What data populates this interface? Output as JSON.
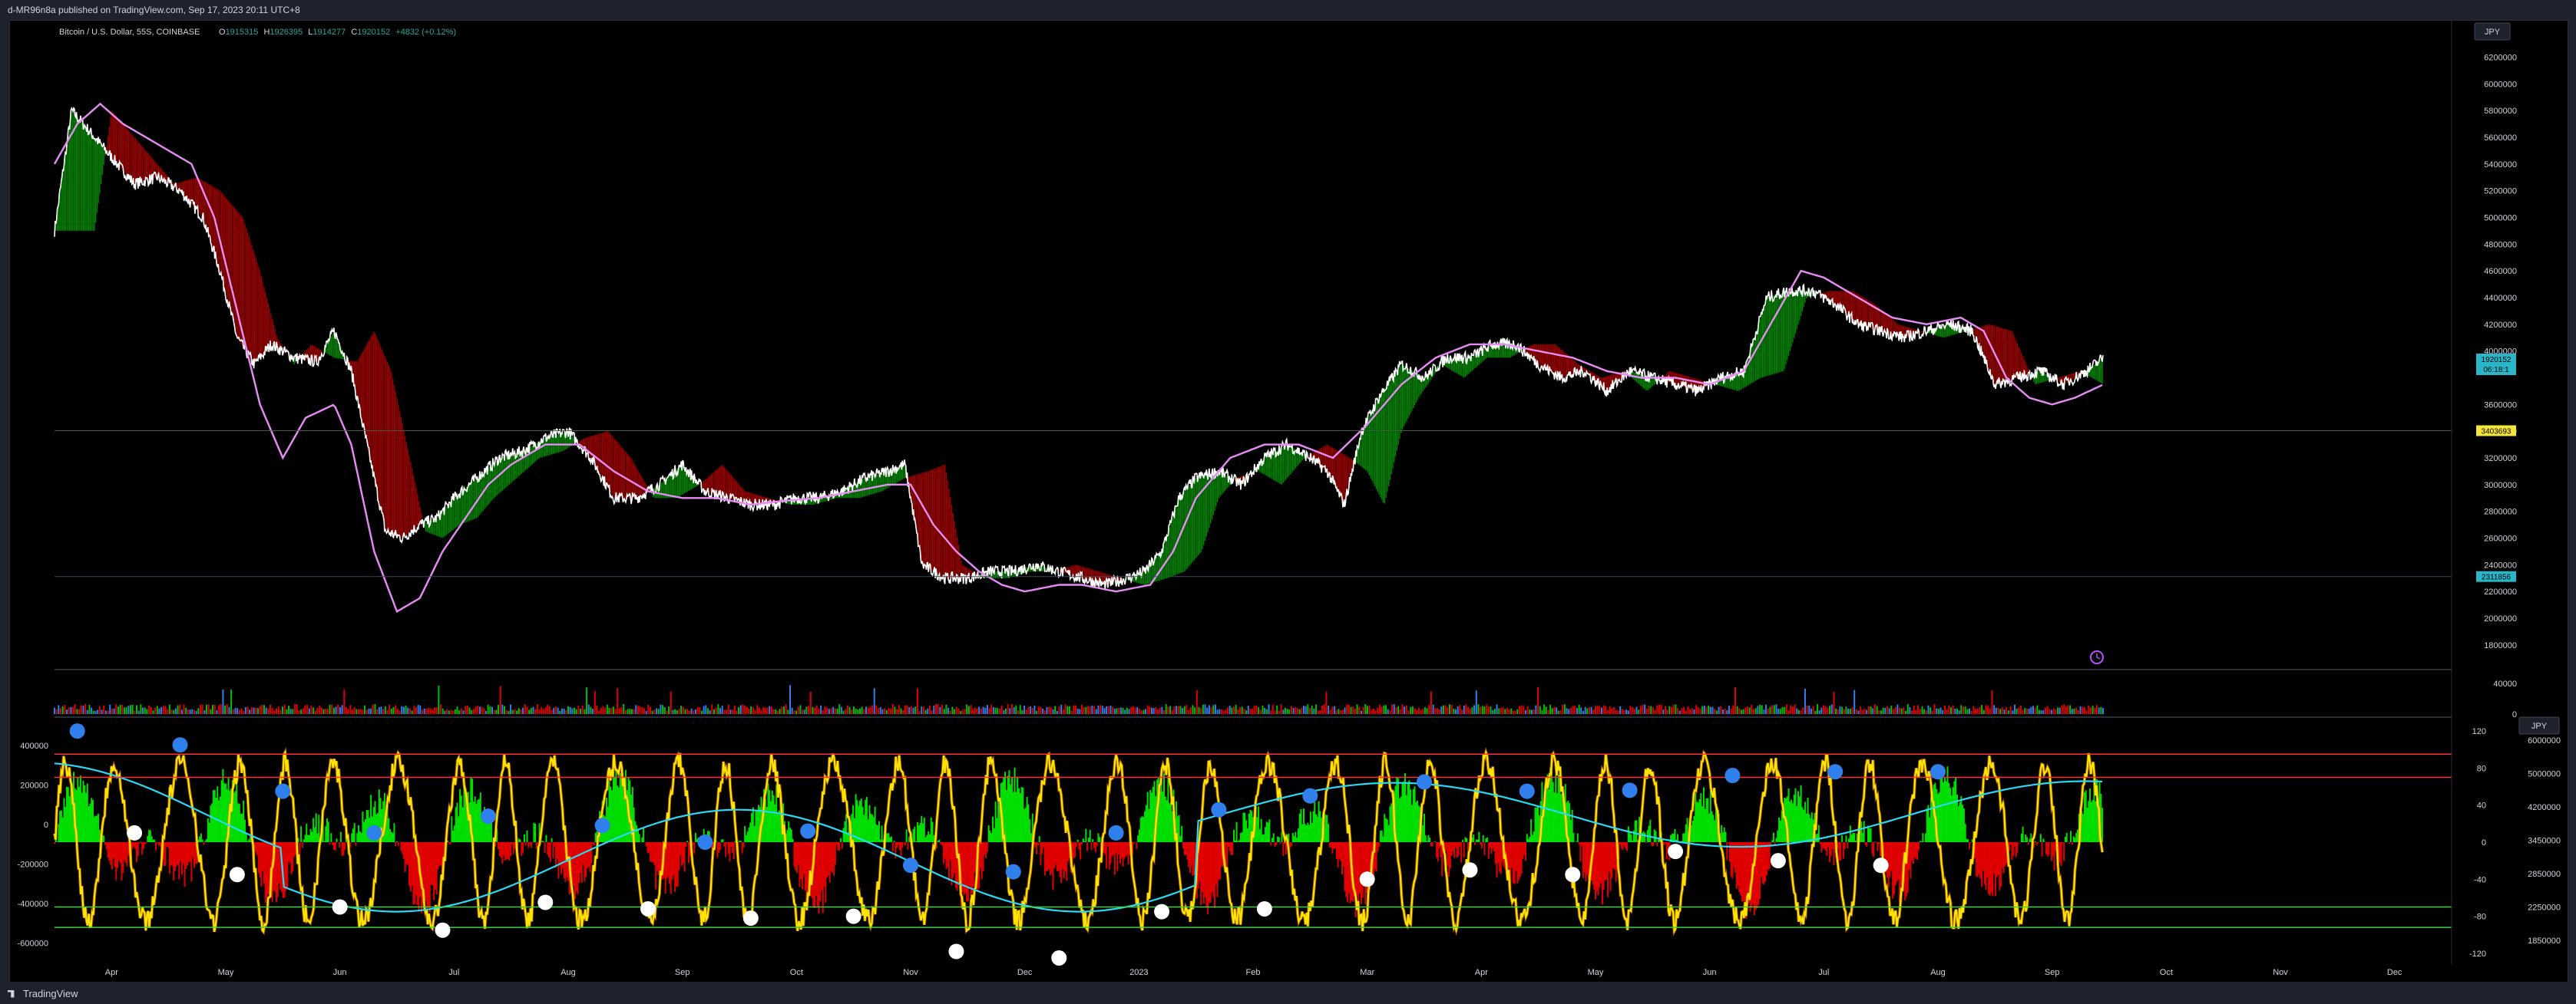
{
  "publish_line": "d-MR96n8a published on TradingView.com, Sep 17, 2023 20:11 UTC+8",
  "brand": "TradingView",
  "header": {
    "symbol": "Bitcoin / U.S. Dollar, 55S, COINBASE",
    "o_label": "O",
    "o_value": "1915315",
    "h_label": "H",
    "h_value": "1926395",
    "l_label": "L",
    "l_value": "1914277",
    "c_label": "C",
    "c_value": "1920152",
    "change": "+4832 (+0.12%)"
  },
  "currency_main": "JPY",
  "currency_osc": "JPY",
  "price_tag": "1920152",
  "countdown": "06:18:1",
  "hline_upper_value": "3403693",
  "hline_lower_value": "2311856",
  "colors": {
    "background": "#000000",
    "price_line": "#ffffff",
    "ma_magenta": "#e88cf5",
    "ribbon_up": "#00c000",
    "ribbon_down": "#e00000",
    "osc_yellow": "#ffe500",
    "osc_cyan": "#29d9f5",
    "hist_up": "#00e000",
    "hist_down": "#e00000",
    "level_red": "#ff3030",
    "level_green": "#40d040",
    "dot_blue": "#2f80ed",
    "dot_white": "#ffffff",
    "tag_blue": "#29b6c8",
    "tag_yellow": "#f5e53a"
  },
  "chart_data": [
    {
      "type": "line",
      "pane": "price",
      "x_ticks": [
        "Apr",
        "May",
        "Jun",
        "Jul",
        "Aug",
        "Sep",
        "Oct",
        "Nov",
        "Dec",
        "2023",
        "Feb",
        "Mar",
        "Apr",
        "May",
        "Jun",
        "Jul",
        "Aug",
        "Sep",
        "Oct",
        "Nov",
        "Dec"
      ],
      "x_tick_pos": [
        0.5,
        1.5,
        2.5,
        3.5,
        4.5,
        5.5,
        6.5,
        7.5,
        8.5,
        9.5,
        10.5,
        11.5,
        12.5,
        13.5,
        14.5,
        15.5,
        16.5,
        17.5,
        18.5,
        19.5,
        20.5
      ],
      "x_range": [
        0,
        21
      ],
      "y_ticks": [
        "6200000",
        "6000000",
        "5800000",
        "5600000",
        "5400000",
        "5200000",
        "5000000",
        "4800000",
        "4600000",
        "4400000",
        "4200000",
        "4000000",
        "3600000",
        "3400000",
        "3200000",
        "3000000",
        "2800000",
        "2600000",
        "2400000",
        "2200000",
        "2000000",
        "1800000"
      ],
      "ylim": [
        1650000,
        6300000
      ],
      "series": [
        {
          "values": [
            [
              0,
              4900000
            ],
            [
              0.15,
              5800000
            ],
            [
              0.3,
              5650000
            ],
            [
              0.5,
              5450000
            ],
            [
              0.7,
              5250000
            ],
            [
              0.9,
              5300000
            ],
            [
              1.1,
              5200000
            ],
            [
              1.3,
              5000000
            ],
            [
              1.45,
              4600000
            ],
            [
              1.6,
              4100000
            ],
            [
              1.75,
              3900000
            ],
            [
              1.9,
              4050000
            ],
            [
              2.1,
              3950000
            ],
            [
              2.3,
              3920000
            ],
            [
              2.45,
              4150000
            ],
            [
              2.6,
              3850000
            ],
            [
              2.75,
              3250000
            ],
            [
              2.9,
              2650000
            ],
            [
              3.05,
              2600000
            ],
            [
              3.2,
              2700000
            ],
            [
              3.35,
              2750000
            ],
            [
              3.5,
              2900000
            ],
            [
              3.7,
              3050000
            ],
            [
              3.9,
              3200000
            ],
            [
              4.1,
              3250000
            ],
            [
              4.3,
              3350000
            ],
            [
              4.5,
              3400000
            ],
            [
              4.7,
              3200000
            ],
            [
              4.9,
              2900000
            ],
            [
              5.1,
              2900000
            ],
            [
              5.3,
              3000000
            ],
            [
              5.5,
              3150000
            ],
            [
              5.7,
              2950000
            ],
            [
              5.9,
              2900000
            ],
            [
              6.1,
              2850000
            ],
            [
              6.3,
              2850000
            ],
            [
              6.5,
              2900000
            ],
            [
              6.7,
              2900000
            ],
            [
              6.9,
              2950000
            ],
            [
              7.1,
              3050000
            ],
            [
              7.3,
              3100000
            ],
            [
              7.45,
              3150000
            ],
            [
              7.6,
              2400000
            ],
            [
              7.8,
              2300000
            ],
            [
              8.0,
              2300000
            ],
            [
              8.2,
              2350000
            ],
            [
              8.4,
              2350000
            ],
            [
              8.6,
              2400000
            ],
            [
              8.8,
              2350000
            ],
            [
              9.0,
              2300000
            ],
            [
              9.2,
              2250000
            ],
            [
              9.4,
              2300000
            ],
            [
              9.55,
              2350000
            ],
            [
              9.7,
              2500000
            ],
            [
              9.85,
              2900000
            ],
            [
              10.0,
              3050000
            ],
            [
              10.2,
              3100000
            ],
            [
              10.4,
              3000000
            ],
            [
              10.6,
              3200000
            ],
            [
              10.8,
              3300000
            ],
            [
              11.0,
              3200000
            ],
            [
              11.15,
              3100000
            ],
            [
              11.3,
              2850000
            ],
            [
              11.45,
              3400000
            ],
            [
              11.6,
              3650000
            ],
            [
              11.8,
              3900000
            ],
            [
              12.0,
              3800000
            ],
            [
              12.2,
              3950000
            ],
            [
              12.4,
              3950000
            ],
            [
              12.6,
              4050000
            ],
            [
              12.8,
              4050000
            ],
            [
              13.0,
              3900000
            ],
            [
              13.2,
              3800000
            ],
            [
              13.4,
              3850000
            ],
            [
              13.6,
              3700000
            ],
            [
              13.8,
              3850000
            ],
            [
              14.0,
              3800000
            ],
            [
              14.2,
              3750000
            ],
            [
              14.4,
              3700000
            ],
            [
              14.6,
              3800000
            ],
            [
              14.8,
              3850000
            ],
            [
              15.0,
              4400000
            ],
            [
              15.2,
              4450000
            ],
            [
              15.4,
              4450000
            ],
            [
              15.6,
              4350000
            ],
            [
              15.8,
              4200000
            ],
            [
              16.0,
              4150000
            ],
            [
              16.2,
              4100000
            ],
            [
              16.4,
              4150000
            ],
            [
              16.6,
              4200000
            ],
            [
              16.8,
              4150000
            ],
            [
              17.0,
              3750000
            ],
            [
              17.2,
              3800000
            ],
            [
              17.4,
              3850000
            ],
            [
              17.6,
              3750000
            ],
            [
              17.8,
              3850000
            ],
            [
              17.95,
              3950000
            ]
          ]
        },
        {
          "values": [
            [
              0,
              5400000
            ],
            [
              0.2,
              5700000
            ],
            [
              0.4,
              5850000
            ],
            [
              0.6,
              5700000
            ],
            [
              0.9,
              5550000
            ],
            [
              1.2,
              5400000
            ],
            [
              1.4,
              5000000
            ],
            [
              1.6,
              4300000
            ],
            [
              1.8,
              3600000
            ],
            [
              2.0,
              3200000
            ],
            [
              2.2,
              3500000
            ],
            [
              2.45,
              3600000
            ],
            [
              2.6,
              3300000
            ],
            [
              2.8,
              2500000
            ],
            [
              3.0,
              2050000
            ],
            [
              3.2,
              2150000
            ],
            [
              3.4,
              2500000
            ],
            [
              3.6,
              2750000
            ],
            [
              3.8,
              3000000
            ],
            [
              4.0,
              3150000
            ],
            [
              4.3,
              3300000
            ],
            [
              4.6,
              3300000
            ],
            [
              4.9,
              3100000
            ],
            [
              5.2,
              2950000
            ],
            [
              5.5,
              2900000
            ],
            [
              5.8,
              2900000
            ],
            [
              6.1,
              2850000
            ],
            [
              6.4,
              2880000
            ],
            [
              6.7,
              2900000
            ],
            [
              7.0,
              2950000
            ],
            [
              7.3,
              3000000
            ],
            [
              7.5,
              3000000
            ],
            [
              7.7,
              2700000
            ],
            [
              7.9,
              2500000
            ],
            [
              8.1,
              2350000
            ],
            [
              8.3,
              2250000
            ],
            [
              8.5,
              2200000
            ],
            [
              8.8,
              2250000
            ],
            [
              9.0,
              2250000
            ],
            [
              9.3,
              2200000
            ],
            [
              9.6,
              2250000
            ],
            [
              9.8,
              2500000
            ],
            [
              10.0,
              2900000
            ],
            [
              10.3,
              3200000
            ],
            [
              10.6,
              3300000
            ],
            [
              10.9,
              3300000
            ],
            [
              11.2,
              3200000
            ],
            [
              11.5,
              3450000
            ],
            [
              11.8,
              3750000
            ],
            [
              12.1,
              3950000
            ],
            [
              12.4,
              4050000
            ],
            [
              12.7,
              4050000
            ],
            [
              13.0,
              4000000
            ],
            [
              13.3,
              3950000
            ],
            [
              13.6,
              3850000
            ],
            [
              13.9,
              3800000
            ],
            [
              14.2,
              3800000
            ],
            [
              14.5,
              3750000
            ],
            [
              14.8,
              3850000
            ],
            [
              15.1,
              4300000
            ],
            [
              15.3,
              4600000
            ],
            [
              15.5,
              4550000
            ],
            [
              15.8,
              4400000
            ],
            [
              16.1,
              4250000
            ],
            [
              16.4,
              4200000
            ],
            [
              16.7,
              4250000
            ],
            [
              16.9,
              4150000
            ],
            [
              17.1,
              3800000
            ],
            [
              17.3,
              3650000
            ],
            [
              17.5,
              3600000
            ],
            [
              17.7,
              3650000
            ],
            [
              17.95,
              3750000
            ]
          ]
        }
      ]
    },
    {
      "type": "bar",
      "pane": "volume",
      "y_ticks": [
        "40000",
        "0"
      ],
      "ylim": [
        0,
        48000
      ]
    },
    {
      "type": "line",
      "pane": "oscillator",
      "y_ticks_left": [
        "400000",
        "200000",
        "0",
        "-200000",
        "-400000",
        "-600000"
      ],
      "ylim_left": [
        -700000,
        520000
      ],
      "y_ticks_right": [
        "120",
        "80",
        "40",
        "0",
        "-40",
        "-80",
        "-120"
      ],
      "ylim_right": [
        -130,
        130
      ],
      "y_ticks_right2": [
        "6000000",
        "5000000",
        "4200000",
        "3450000",
        "2850000",
        "2250000",
        "1850000"
      ],
      "levels_right": [
        {
          "value": 95,
          "color": "red"
        },
        {
          "value": 70,
          "color": "red"
        },
        {
          "value": -70,
          "color": "green"
        },
        {
          "value": -92,
          "color": "green"
        }
      ],
      "blue_dots": [
        [
          0.2,
          120
        ],
        [
          1.1,
          105
        ],
        [
          2.0,
          55
        ],
        [
          2.8,
          10
        ],
        [
          3.8,
          28
        ],
        [
          4.8,
          18
        ],
        [
          5.7,
          0
        ],
        [
          6.6,
          12
        ],
        [
          7.5,
          -25
        ],
        [
          8.4,
          -32
        ],
        [
          9.3,
          10
        ],
        [
          10.2,
          35
        ],
        [
          11.0,
          50
        ],
        [
          12.0,
          65
        ],
        [
          12.9,
          55
        ],
        [
          13.8,
          56
        ],
        [
          14.7,
          72
        ],
        [
          15.6,
          76
        ],
        [
          16.5,
          76
        ]
      ],
      "white_dots": [
        [
          0.7,
          10
        ],
        [
          1.6,
          -35
        ],
        [
          2.5,
          -70
        ],
        [
          3.4,
          -95
        ],
        [
          4.3,
          -65
        ],
        [
          5.2,
          -72
        ],
        [
          6.1,
          -82
        ],
        [
          7.0,
          -80
        ],
        [
          7.9,
          -118
        ],
        [
          8.8,
          -125
        ],
        [
          9.7,
          -75
        ],
        [
          10.6,
          -72
        ],
        [
          11.5,
          -40
        ],
        [
          12.4,
          -30
        ],
        [
          13.3,
          -35
        ],
        [
          14.2,
          -10
        ],
        [
          15.1,
          -20
        ],
        [
          16.0,
          -25
        ]
      ]
    }
  ]
}
